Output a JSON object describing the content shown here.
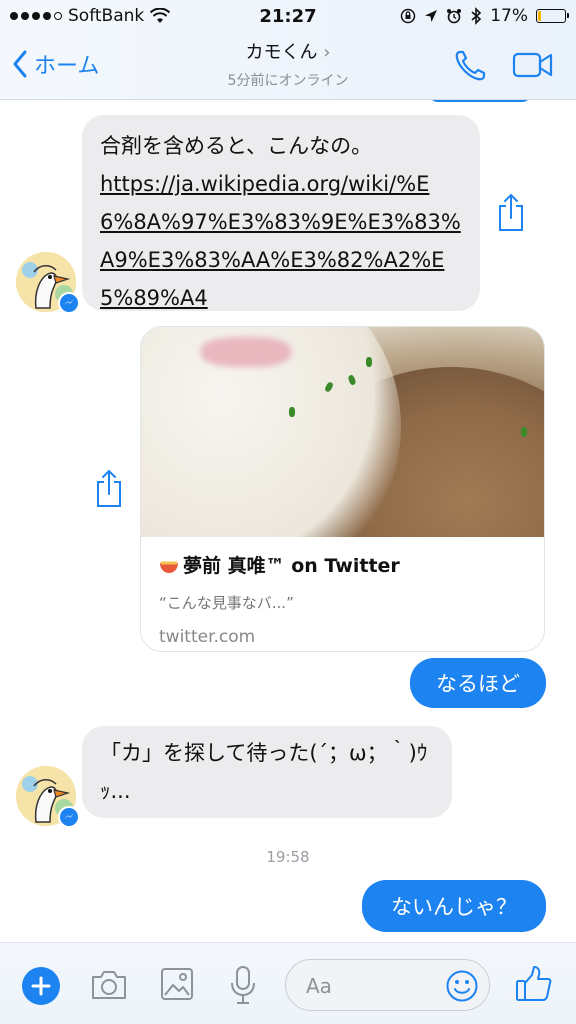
{
  "status_bar": {
    "carrier": "SoftBank",
    "time": "21:27",
    "battery_percent": "17%",
    "battery_level": 0.17
  },
  "header": {
    "back_label": "ホーム",
    "contact_name": "カモくん",
    "contact_status": "5分前にオンライン"
  },
  "messages": {
    "m1_text": "合剤を含めると、こんなの。",
    "m1_link": "https://ja.wikipedia.org/wiki/%E6%8A%97%E3%83%9E%E3%83%A9%E3%83%AA%E3%82%A2%E5%89%A4",
    "card_title": "夢前 真唯™ on Twitter",
    "card_desc": "“こんな見事なバ...”",
    "card_domain": "twitter.com",
    "m2_text": "なるほど",
    "m3_text": "「カ」を探して待った(´；ω；｀)ｳｯ...",
    "timestamp": "19:58",
    "m4_text": "ないんじゃ？"
  },
  "composer": {
    "placeholder": "Aa"
  },
  "colors": {
    "accent": "#1d83f0",
    "incoming_bubble": "#ececee",
    "battery": "#f0b400"
  }
}
